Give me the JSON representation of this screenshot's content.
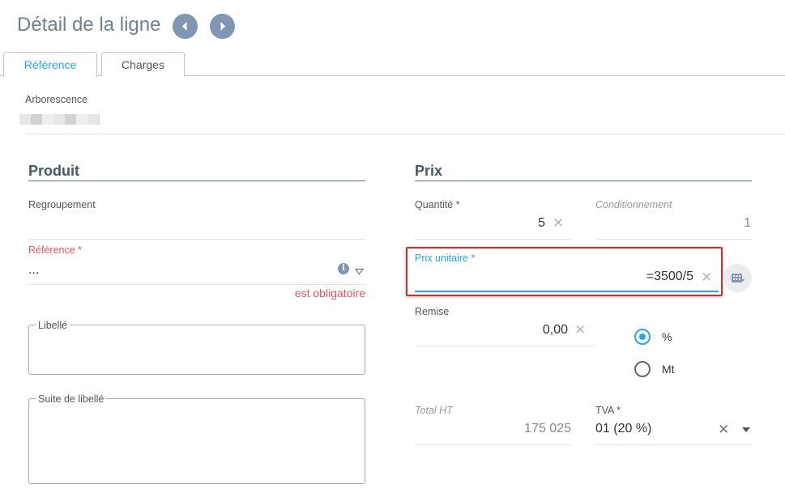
{
  "header": {
    "title": "Détail de la ligne",
    "prev_icon": "chevron-left-icon",
    "next_icon": "chevron-right-icon"
  },
  "tabs": [
    {
      "label": "Référence",
      "active": true
    },
    {
      "label": "Charges",
      "active": false
    }
  ],
  "arborescence": {
    "label": "Arborescence"
  },
  "produit": {
    "title": "Produit",
    "regroupement_label": "Regroupement",
    "reference_label": "Référence *",
    "reference_value": "...",
    "reference_error": "est obligatoire",
    "libelle_label": "Libellé",
    "suite_libelle_label": "Suite de libellé"
  },
  "prix": {
    "title": "Prix",
    "quantite_label": "Quantité *",
    "quantite_value": "5",
    "conditionnement_label": "Conditionnement",
    "conditionnement_value": "1",
    "prix_unitaire_label": "Prix unitaire *",
    "prix_unitaire_value": "=3500/5",
    "remise_label": "Remise",
    "remise_value": "0,00",
    "remise_type_options": [
      "%",
      "Mt"
    ],
    "remise_type_selected": "%",
    "total_ht_label": "Total HT",
    "total_ht_value": "175 025",
    "tva_label": "TVA *",
    "tva_value": "01 (20 %)"
  },
  "colors": {
    "accent": "#29a8e0",
    "error": "#e05563",
    "highlight": "#d42a2a",
    "title": "#6b8199"
  }
}
